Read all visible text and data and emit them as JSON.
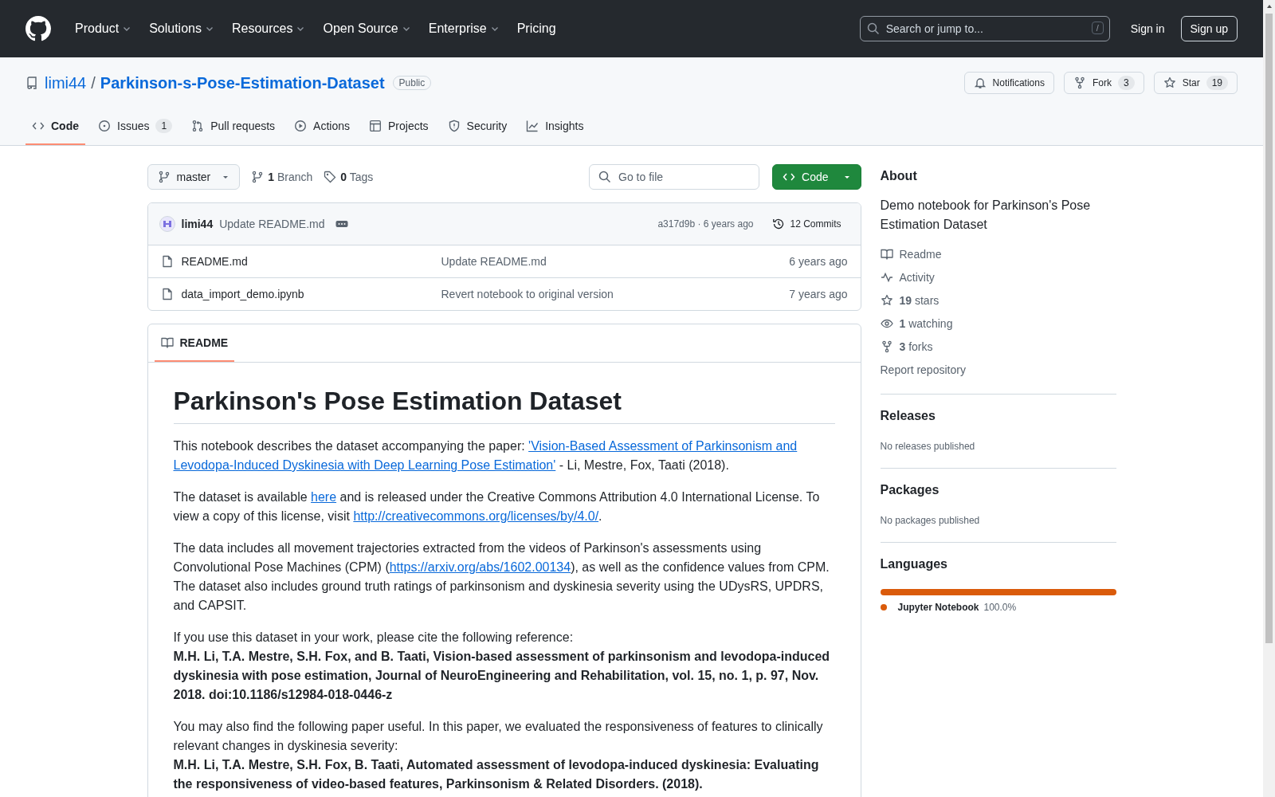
{
  "header": {
    "nav": [
      {
        "label": "Product",
        "dropdown": true
      },
      {
        "label": "Solutions",
        "dropdown": true
      },
      {
        "label": "Resources",
        "dropdown": true
      },
      {
        "label": "Open Source",
        "dropdown": true
      },
      {
        "label": "Enterprise",
        "dropdown": true
      },
      {
        "label": "Pricing",
        "dropdown": false
      }
    ],
    "search": {
      "placeholder": "Search or jump to...",
      "key": "/"
    },
    "sign_in": "Sign in",
    "sign_up": "Sign up"
  },
  "repo": {
    "owner": "limi44",
    "separator": "/",
    "name": "Parkinson-s-Pose-Estimation-Dataset",
    "visibility": "Public",
    "actions": [
      {
        "kind": "bell",
        "label": "Notifications"
      },
      {
        "kind": "fork",
        "label": "Fork",
        "count": "3"
      },
      {
        "kind": "star",
        "label": "Star",
        "count": "19"
      }
    ]
  },
  "tabs": [
    {
      "kind": "code",
      "label": "Code",
      "selected": true
    },
    {
      "kind": "issue",
      "label": "Issues",
      "count": "1",
      "selected": false
    },
    {
      "kind": "pr",
      "label": "Pull requests",
      "selected": false
    },
    {
      "kind": "play",
      "label": "Actions",
      "selected": false
    },
    {
      "kind": "table",
      "label": "Projects",
      "selected": false
    },
    {
      "kind": "shield",
      "label": "Security",
      "selected": false
    },
    {
      "kind": "graph",
      "label": "Insights",
      "selected": false
    }
  ],
  "toolbar": {
    "branch": "master",
    "branches": {
      "count": "1",
      "label": "Branch"
    },
    "tags": {
      "count": "0",
      "label": "Tags"
    },
    "go_to_file": {
      "placeholder": "Go to file"
    },
    "code_button": "Code"
  },
  "commit": {
    "author": "limi44",
    "message": "Update README.md",
    "hash": "a317d9b · 6 years ago",
    "commits": "12 Commits"
  },
  "files": [
    {
      "name": "README.md",
      "message": "Update README.md",
      "age": "6 years ago"
    },
    {
      "name": "data_import_demo.ipynb",
      "message": "Revert notebook to original version",
      "age": "7 years ago"
    }
  ],
  "readme": {
    "tab": "README",
    "title": "Parkinson's Pose Estimation Dataset",
    "paragraphs": [
      {
        "parts": [
          {
            "kind": "text",
            "text": "This notebook describes the dataset accompanying the paper: "
          },
          {
            "kind": "link",
            "text": "'Vision-Based Assessment of Parkinsonism and"
          },
          {
            "kind": "link",
            "text": "Levodopa-Induced Dyskinesia with Deep Learning Pose Estimation'"
          },
          {
            "kind": "text",
            "text": " - Li, Mestre, Fox, Taati (2018)."
          }
        ]
      },
      {
        "parts": [
          {
            "kind": "text",
            "text": "The dataset is available "
          },
          {
            "kind": "link",
            "text": "here"
          },
          {
            "kind": "text",
            "text": " and is released under the Creative Commons Attribution 4.0 International License. To view a copy of this license, visit "
          },
          {
            "kind": "link",
            "text": "http://creativecommons.org/licenses/by/4.0/"
          },
          {
            "kind": "text",
            "text": "."
          }
        ]
      },
      {
        "parts": [
          {
            "kind": "text",
            "text": "The data includes all movement trajectories extracted from the videos of Parkinson's assessments using Convolutional Pose Machines (CPM) ("
          },
          {
            "kind": "link",
            "text": "https://arxiv.org/abs/1602.00134"
          },
          {
            "kind": "text",
            "text": "), as well as the confidence values from CPM. The dataset also includes ground truth ratings of parkinsonism and dyskinesia severity using the UDysRS, UPDRS, and CAPSIT."
          }
        ]
      },
      {
        "parts": [
          {
            "kind": "text",
            "text": "If you use this dataset in your work, please cite the following reference:"
          },
          {
            "kind": "citation",
            "text": "M.H. Li, T.A. Mestre, S.H. Fox, and B. Taati, Vision-based assessment of parkinsonism and levodopa-induced dyskinesia with pose estimation, Journal of NeuroEngineering and Rehabilitation, vol. 15, no. 1, p. 97, Nov. 2018. doi:10.1186/s12984-018-0446-z"
          }
        ]
      },
      {
        "parts": [
          {
            "kind": "text",
            "text": "You may also find the following paper useful. In this paper, we evaluated the responsiveness of features to clinically relevant changes in dyskinesia severity:"
          },
          {
            "kind": "citation",
            "text": "M.H. Li, T.A. Mestre, S.H. Fox, B. Taati, Automated assessment of levodopa-induced dyskinesia: Evaluating the responsiveness of video-based features, Parkinsonism & Related Disorders. (2018)."
          }
        ]
      }
    ]
  },
  "about": {
    "title": "About",
    "description": "Demo notebook for Parkinson's Pose Estimation Dataset",
    "links": [
      {
        "kind": "book",
        "text": "Readme"
      },
      {
        "kind": "pulse",
        "text": "Activity"
      },
      {
        "kind": "star",
        "text": "**19** stars"
      },
      {
        "kind": "eye",
        "text": "**1** watching"
      },
      {
        "kind": "fork",
        "text": "**3** forks"
      }
    ],
    "report": "Report repository"
  },
  "releases": {
    "title": "Releases",
    "note": "No releases published"
  },
  "packages": {
    "title": "Packages",
    "note": "No packages published"
  },
  "languages": {
    "title": "Languages",
    "items": [
      {
        "name": "Jupyter Notebook",
        "percent": "100.0%",
        "level": 1.0,
        "color": "#da5b0b"
      }
    ]
  }
}
